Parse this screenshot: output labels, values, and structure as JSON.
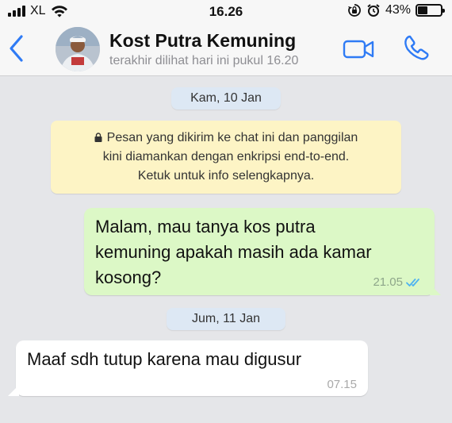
{
  "status_bar": {
    "carrier": "XL",
    "time": "16.26",
    "battery_percent": "43%",
    "battery_level": 0.43,
    "icons": [
      "signal-icon",
      "wifi-icon",
      "rotation-lock-icon",
      "alarm-icon",
      "battery-icon"
    ]
  },
  "header": {
    "contact_name": "Kost Putra Kemuning",
    "last_seen": "terakhir dilihat hari ini pukul 16.20",
    "icons": [
      "back-chevron-icon",
      "video-call-icon",
      "phone-call-icon"
    ],
    "accent_color": "#2f7bf5"
  },
  "chat": {
    "date_1": "Kam, 10 Jan",
    "encryption_notice": {
      "line1": "Pesan yang dikirim ke chat ini dan panggilan",
      "line2": "kini diamankan dengan enkripsi end-to-end.",
      "line3": "Ketuk untuk info selengkapnya."
    },
    "outgoing": {
      "line1": "Malam, mau tanya kos putra",
      "line2": "kemuning apakah masih ada kamar",
      "line3": "kosong?",
      "time": "21.05",
      "status": "read"
    },
    "date_2": "Jum, 11 Jan",
    "incoming": {
      "text": "Maaf sdh tutup karena mau digusur",
      "time": "07.15"
    }
  },
  "colors": {
    "chat_background": "#e5e6e9",
    "outgoing_bubble": "#dcf8c6",
    "incoming_bubble": "#ffffff",
    "notice_bubble": "#fdf4c5",
    "date_pill": "#dde8f4",
    "read_ticks": "#4fb3f0"
  }
}
